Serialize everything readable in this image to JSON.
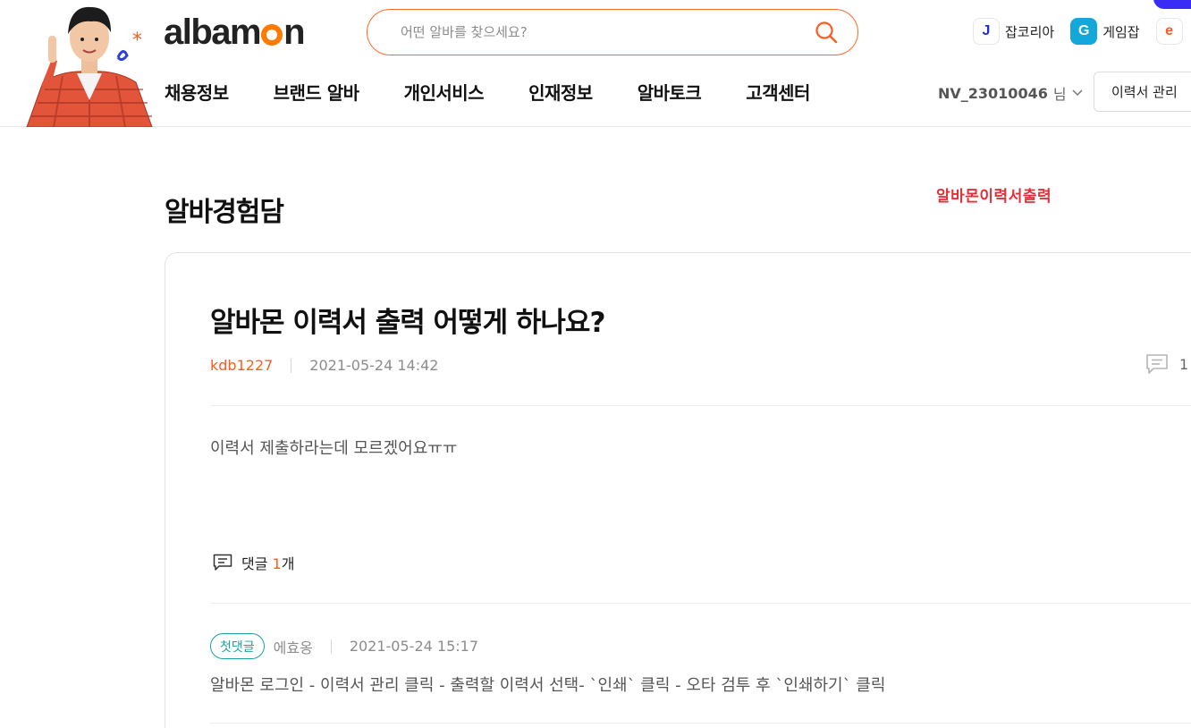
{
  "header": {
    "logo_text_a": "alba",
    "logo_text_b": "m",
    "logo_text_c": "n",
    "search_placeholder": "어떤 알바를 찾으세요?",
    "family_links": [
      {
        "badge": "J",
        "label": "잡코리아",
        "color": "#1f2cd1"
      },
      {
        "badge": "G",
        "label": "게임잡",
        "color": "#14a7d9"
      },
      {
        "badge": "e",
        "label": "",
        "color": "#ff5a1f"
      }
    ],
    "nav": [
      "채용정보",
      "브랜드 알바",
      "개인서비스",
      "인재정보",
      "알바토크",
      "고객센터"
    ],
    "user_id": "NV_23010046",
    "user_suffix": "님",
    "resume_button": "이력서 관리"
  },
  "page": {
    "section_title": "알바경험담",
    "red_note": "알바몬이력서출력"
  },
  "post": {
    "title": "알바몬 이력서 출력 어떻게 하나요?",
    "author": "kdb1227",
    "date": "2021-05-24 14:42",
    "comment_count": "1",
    "body": "이력서 제출하라는데 모르겠어요ㅠㅠ",
    "comments_label_a": "댓글 ",
    "comments_label_num": "1",
    "comments_label_b": "개"
  },
  "comments": [
    {
      "badge": "첫댓글",
      "author": "에효옹",
      "date": "2021-05-24 15:17",
      "text": "알바몬 로그인 - 이력서 관리 클릭 - 출력할 이력서 선택- `인쇄` 클릭 - 오타 검투 후 `인쇄하기` 클릭"
    }
  ],
  "colors": {
    "accent": "#ff5a1f",
    "logo_orange": "#ff7a00",
    "note_red": "#e0303a",
    "badge_teal": "#1aa3a3"
  }
}
